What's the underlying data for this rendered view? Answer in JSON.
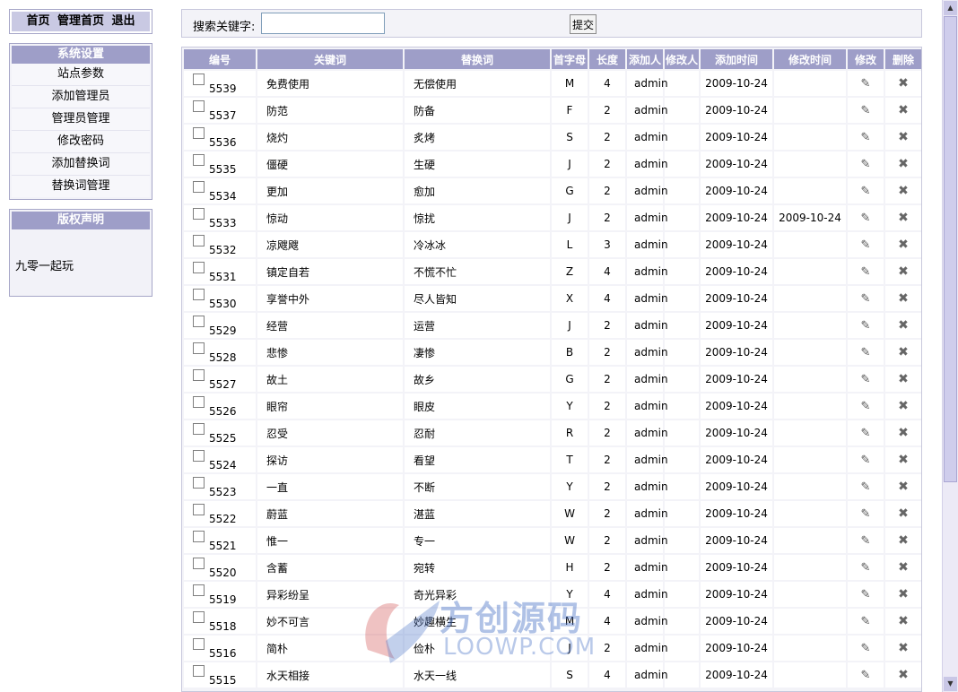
{
  "topnav": {
    "home": "首页",
    "admin_home": "管理首页",
    "logout": "退出"
  },
  "sidebar": {
    "title": "系统设置",
    "items": [
      {
        "label": "站点参数"
      },
      {
        "label": "添加管理员"
      },
      {
        "label": "管理员管理"
      },
      {
        "label": "修改密码"
      },
      {
        "label": "添加替换词"
      },
      {
        "label": "替换词管理"
      }
    ]
  },
  "copyright": {
    "title": "版权声明",
    "text": "九零一起玩"
  },
  "search": {
    "label": "搜索关键字:",
    "value": "",
    "submit": "提交"
  },
  "table": {
    "headers": [
      "编号",
      "关键词",
      "替换词",
      "首字母",
      "长度",
      "添加人",
      "修改人",
      "添加时间",
      "修改时间",
      "修改",
      "删除"
    ],
    "rows": [
      {
        "id": "5539",
        "kw": "免费使用",
        "rep": "无偿使用",
        "ini": "M",
        "len": "4",
        "adder": "admin",
        "date": "2009-10-24",
        "mdate": ""
      },
      {
        "id": "5537",
        "kw": "防范",
        "rep": "防备",
        "ini": "F",
        "len": "2",
        "adder": "admin",
        "date": "2009-10-24",
        "mdate": ""
      },
      {
        "id": "5536",
        "kw": "烧灼",
        "rep": "炙烤",
        "ini": "S",
        "len": "2",
        "adder": "admin",
        "date": "2009-10-24",
        "mdate": ""
      },
      {
        "id": "5535",
        "kw": "僵硬",
        "rep": "生硬",
        "ini": "J",
        "len": "2",
        "adder": "admin",
        "date": "2009-10-24",
        "mdate": ""
      },
      {
        "id": "5534",
        "kw": "更加",
        "rep": "愈加",
        "ini": "G",
        "len": "2",
        "adder": "admin",
        "date": "2009-10-24",
        "mdate": ""
      },
      {
        "id": "5533",
        "kw": "惊动",
        "rep": "惊扰",
        "ini": "J",
        "len": "2",
        "adder": "admin",
        "date": "2009-10-24",
        "mdate": "2009-10-24"
      },
      {
        "id": "5532",
        "kw": "凉飕飕",
        "rep": "冷冰冰",
        "ini": "L",
        "len": "3",
        "adder": "admin",
        "date": "2009-10-24",
        "mdate": ""
      },
      {
        "id": "5531",
        "kw": "镇定自若",
        "rep": "不慌不忙",
        "ini": "Z",
        "len": "4",
        "adder": "admin",
        "date": "2009-10-24",
        "mdate": ""
      },
      {
        "id": "5530",
        "kw": "享誉中外",
        "rep": "尽人皆知",
        "ini": "X",
        "len": "4",
        "adder": "admin",
        "date": "2009-10-24",
        "mdate": ""
      },
      {
        "id": "5529",
        "kw": "经营",
        "rep": "运营",
        "ini": "J",
        "len": "2",
        "adder": "admin",
        "date": "2009-10-24",
        "mdate": ""
      },
      {
        "id": "5528",
        "kw": "悲惨",
        "rep": "凄惨",
        "ini": "B",
        "len": "2",
        "adder": "admin",
        "date": "2009-10-24",
        "mdate": ""
      },
      {
        "id": "5527",
        "kw": "故土",
        "rep": "故乡",
        "ini": "G",
        "len": "2",
        "adder": "admin",
        "date": "2009-10-24",
        "mdate": ""
      },
      {
        "id": "5526",
        "kw": "眼帘",
        "rep": "眼皮",
        "ini": "Y",
        "len": "2",
        "adder": "admin",
        "date": "2009-10-24",
        "mdate": ""
      },
      {
        "id": "5525",
        "kw": "忍受",
        "rep": "忍耐",
        "ini": "R",
        "len": "2",
        "adder": "admin",
        "date": "2009-10-24",
        "mdate": ""
      },
      {
        "id": "5524",
        "kw": "探访",
        "rep": "看望",
        "ini": "T",
        "len": "2",
        "adder": "admin",
        "date": "2009-10-24",
        "mdate": ""
      },
      {
        "id": "5523",
        "kw": "一直",
        "rep": "不断",
        "ini": "Y",
        "len": "2",
        "adder": "admin",
        "date": "2009-10-24",
        "mdate": ""
      },
      {
        "id": "5522",
        "kw": "蔚蓝",
        "rep": "湛蓝",
        "ini": "W",
        "len": "2",
        "adder": "admin",
        "date": "2009-10-24",
        "mdate": ""
      },
      {
        "id": "5521",
        "kw": "惟一",
        "rep": "专一",
        "ini": "W",
        "len": "2",
        "adder": "admin",
        "date": "2009-10-24",
        "mdate": ""
      },
      {
        "id": "5520",
        "kw": "含蓄",
        "rep": "宛转",
        "ini": "H",
        "len": "2",
        "adder": "admin",
        "date": "2009-10-24",
        "mdate": ""
      },
      {
        "id": "5519",
        "kw": "异彩纷呈",
        "rep": "奇光异彩",
        "ini": "Y",
        "len": "4",
        "adder": "admin",
        "date": "2009-10-24",
        "mdate": ""
      },
      {
        "id": "5518",
        "kw": "妙不可言",
        "rep": "妙趣横生",
        "ini": "M",
        "len": "4",
        "adder": "admin",
        "date": "2009-10-24",
        "mdate": ""
      },
      {
        "id": "5516",
        "kw": "简朴",
        "rep": "俭朴",
        "ini": "J",
        "len": "2",
        "adder": "admin",
        "date": "2009-10-24",
        "mdate": ""
      },
      {
        "id": "5515",
        "kw": "水天相接",
        "rep": "水天一线",
        "ini": "S",
        "len": "4",
        "adder": "admin",
        "date": "2009-10-24",
        "mdate": ""
      }
    ]
  },
  "watermark": {
    "cn": "方创源码",
    "en": "LOOWP.COM"
  }
}
